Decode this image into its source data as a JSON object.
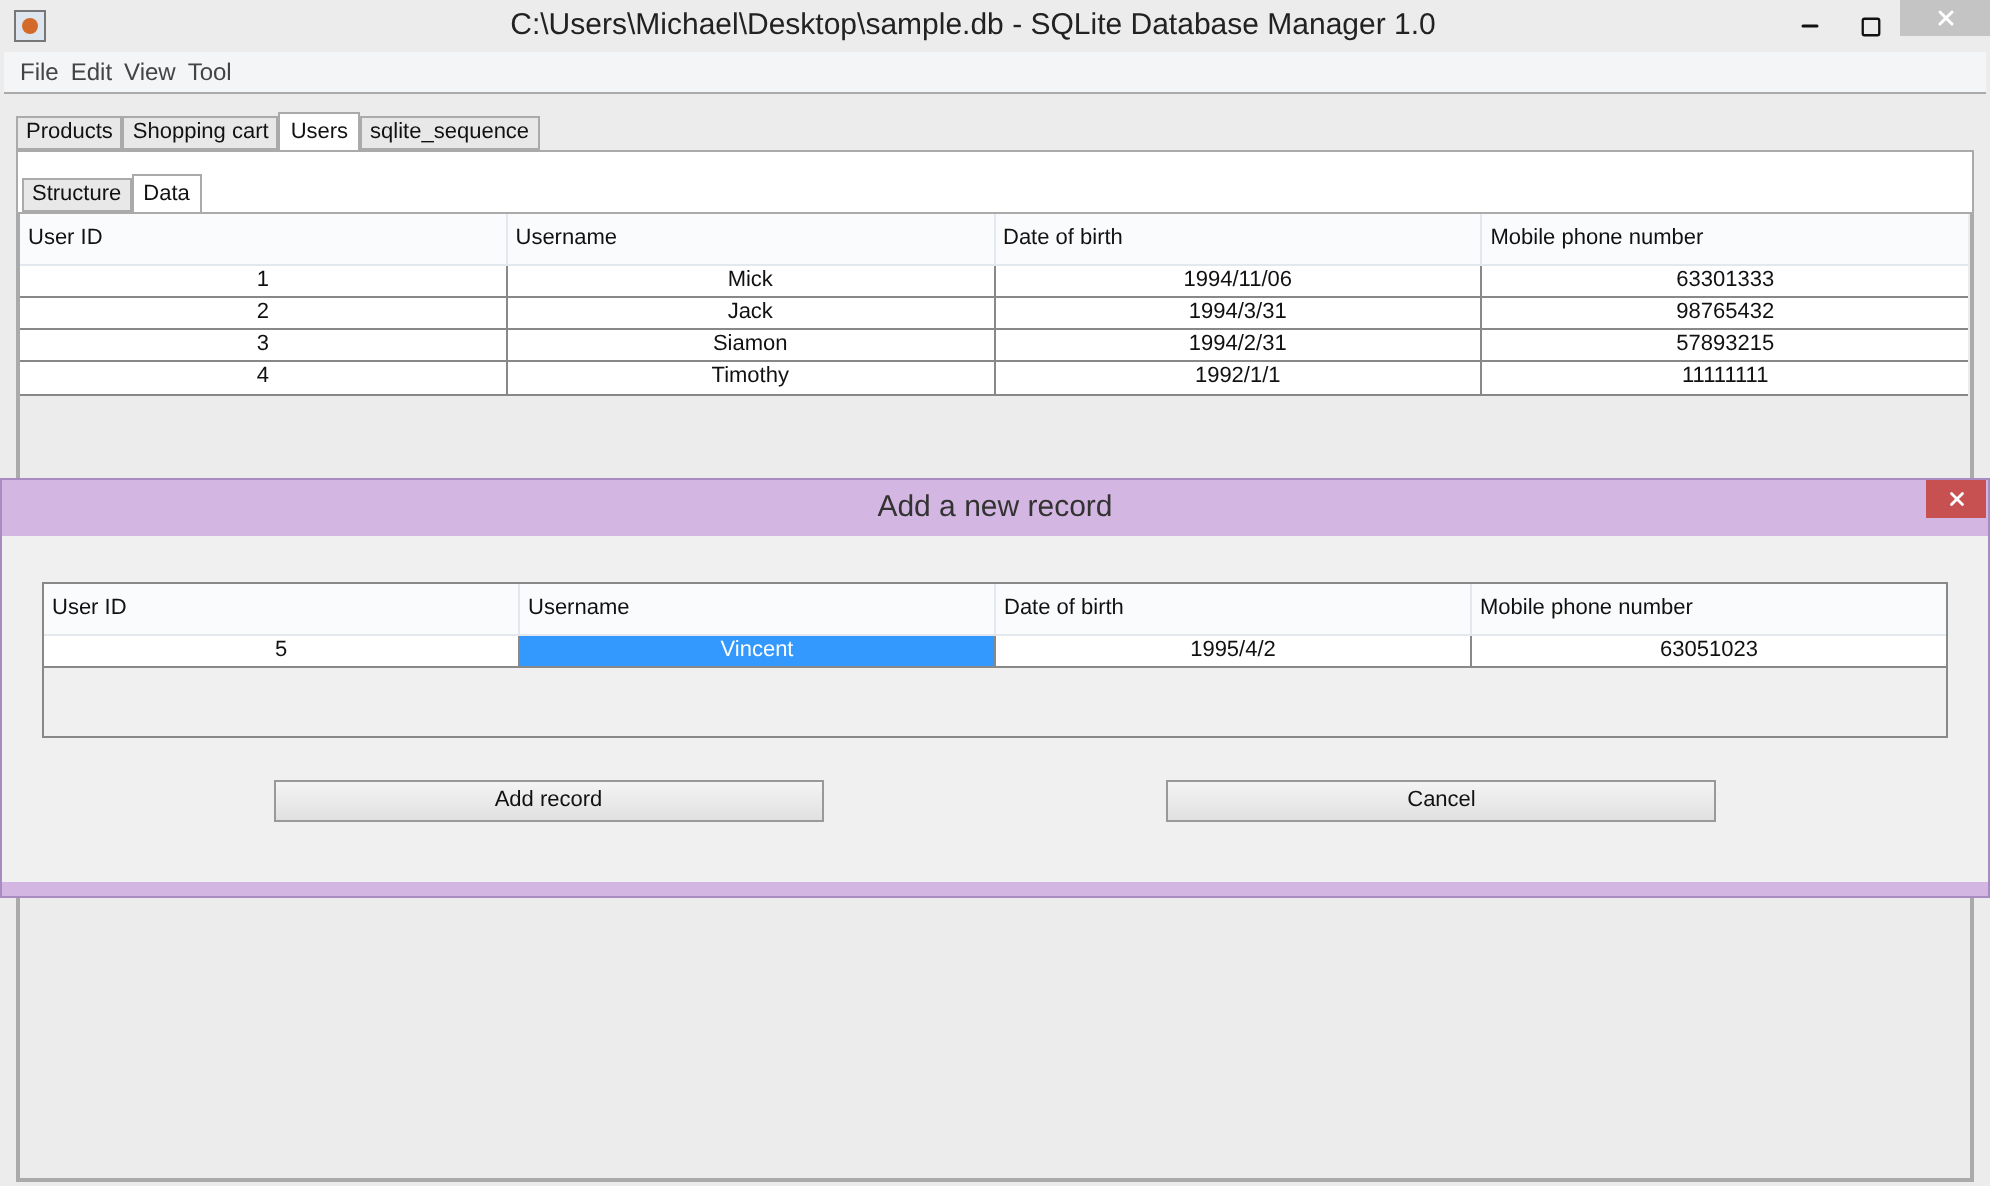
{
  "window": {
    "title": "C:\\Users\\Michael\\Desktop\\sample.db - SQLite Database Manager 1.0"
  },
  "menu": [
    "File",
    "Edit",
    "View",
    "Tool"
  ],
  "tabs": [
    {
      "label": "Products",
      "selected": false
    },
    {
      "label": "Shopping cart",
      "selected": false
    },
    {
      "label": "Users",
      "selected": true
    },
    {
      "label": "sqlite_sequence",
      "selected": false
    }
  ],
  "subtabs": [
    {
      "label": "Structure",
      "selected": false
    },
    {
      "label": "Data",
      "selected": true
    }
  ],
  "table": {
    "columns": [
      "User ID",
      "Username",
      "Date of birth",
      "Mobile phone number"
    ],
    "rows": [
      [
        "1",
        "Mick",
        "1994/11/06",
        "63301333"
      ],
      [
        "2",
        "Jack",
        "1994/3/31",
        "98765432"
      ],
      [
        "3",
        "Siamon",
        "1994/2/31",
        "57893215"
      ],
      [
        "4",
        "Timothy",
        "1992/1/1",
        "11111111"
      ]
    ]
  },
  "dialog": {
    "title": "Add a new record",
    "columns": [
      "User ID",
      "Username",
      "Date of birth",
      "Mobile phone number"
    ],
    "row": [
      {
        "value": "5",
        "selected": false
      },
      {
        "value": "Vincent",
        "selected": true
      },
      {
        "value": "1995/4/2",
        "selected": false
      },
      {
        "value": "63051023",
        "selected": false
      }
    ],
    "buttons": [
      "Add record",
      "Cancel"
    ]
  }
}
